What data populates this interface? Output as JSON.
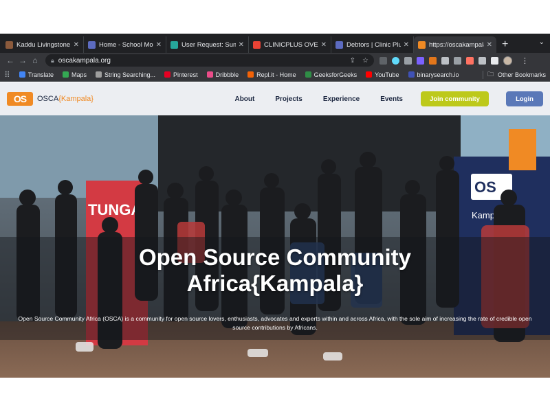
{
  "tabs": [
    {
      "title": "Kaddu Livingstone",
      "favicon_color": "#8b5a3c"
    },
    {
      "title": "Home - School Monitor",
      "favicon_color": "#5c6bc0"
    },
    {
      "title": "User Request: Summary",
      "favicon_color": "#26a69a"
    },
    {
      "title": "CLINICPLUS OVERVIEW",
      "favicon_color": "#ea4335"
    },
    {
      "title": "Debtors | Clinic Plus UI",
      "favicon_color": "#5c6bc0"
    },
    {
      "title": "https://oscakampala.org",
      "favicon_color": "#f08a24",
      "active": true
    }
  ],
  "address": {
    "url": "oscakampala.org"
  },
  "bookmarks": [
    {
      "label": "Translate",
      "color": "#4285f4"
    },
    {
      "label": "Maps",
      "color": "#34a853"
    },
    {
      "label": "String Searching...",
      "color": "#9e9e9e"
    },
    {
      "label": "Pinterest",
      "color": "#e60023"
    },
    {
      "label": "Dribbble",
      "color": "#ea4c89"
    },
    {
      "label": "Repl.it - Home",
      "color": "#f26207"
    },
    {
      "label": "GeeksforGeeks",
      "color": "#2f8d46"
    },
    {
      "label": "YouTube",
      "color": "#ff0000"
    },
    {
      "label": "binarysearch.io",
      "color": "#3f51b5"
    }
  ],
  "other_bookmarks": "Other Bookmarks",
  "site": {
    "logo_mark": "OS",
    "logo_prefix": "OSCA",
    "logo_city": "{Kampala}",
    "menu": [
      "About",
      "Projects",
      "Experience",
      "Events"
    ],
    "join_label": "Join community",
    "login_label": "Login"
  },
  "hero": {
    "title_line1": "Open Source Community",
    "title_line2": "Africa{Kampala}",
    "description": "Open Source Community Africa (OSCA) is a community for open source lovers, enthusiasts, advocates and experts within and across Africa, with the sole aim of increasing the rate of credible open source contributions by Africans."
  },
  "colors": {
    "brand_orange": "#f08a24",
    "join_green": "#bdc91a",
    "login_blue": "#5a78b8",
    "nav_text": "#1c2740"
  }
}
